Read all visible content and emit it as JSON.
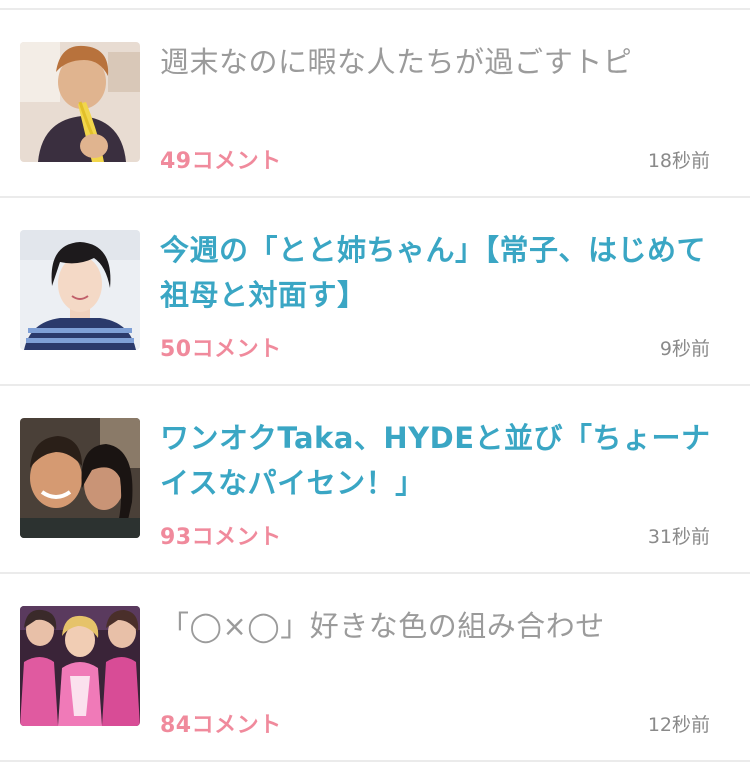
{
  "topics": [
    {
      "title": "週末なのに暇な人たちが過ごすトピ",
      "comments": "49コメント",
      "time": "18秒前",
      "state": "read",
      "thumbnail_icon": "photo-man-banana"
    },
    {
      "title": "今週の「とと姉ちゃん」【常子、はじめて祖母と対面す】",
      "comments": "50コメント",
      "time": "9秒前",
      "state": "unread",
      "thumbnail_icon": "photo-woman-short-hair"
    },
    {
      "title": "ワンオクTaka、HYDEと並び「ちょーナイスなパイセン！」",
      "comments": "93コメント",
      "time": "31秒前",
      "state": "unread",
      "thumbnail_icon": "photo-two-men-selfie"
    },
    {
      "title": "「◯×◯」好きな色の組み合わせ",
      "comments": "84コメント",
      "time": "12秒前",
      "state": "read",
      "thumbnail_icon": "photo-idol-group-pink"
    }
  ],
  "colors": {
    "read_title": "#9b9b9b",
    "unread_title": "#3aa6c4",
    "comment_count": "#f08a9c",
    "timestamp": "#8a8a8a",
    "divider": "#ebebeb"
  }
}
